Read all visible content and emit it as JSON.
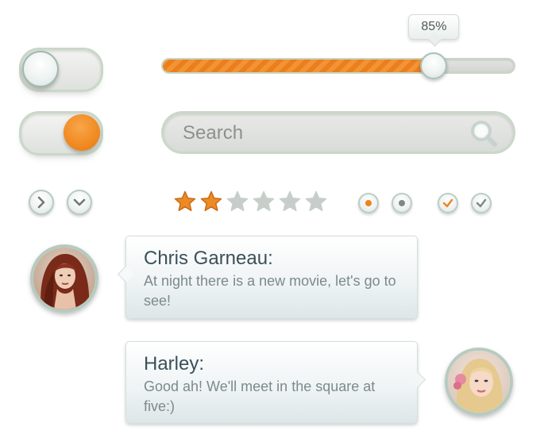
{
  "colors": {
    "accent": "#f08a21",
    "border": "#c9d8c8",
    "text_dark": "#3b5059",
    "text_muted": "#7c8a8e"
  },
  "toggles": [
    {
      "state": "off"
    },
    {
      "state": "on"
    }
  ],
  "slider": {
    "value_label": "85%",
    "value_fraction": 0.77
  },
  "search": {
    "placeholder": "Search",
    "icon": "magnifier-icon"
  },
  "nav_buttons": [
    {
      "icon": "chevron-right-icon"
    },
    {
      "icon": "chevron-down-icon"
    }
  ],
  "rating": {
    "value": 2,
    "max": 6
  },
  "radios": [
    {
      "selected": true
    },
    {
      "selected": false
    }
  ],
  "checkboxes": [
    {
      "checked": true
    },
    {
      "checked": false
    }
  ],
  "chat": [
    {
      "name": "Chris Garneau:",
      "message": "At night there is a new movie, let's go to see!",
      "avatar": "avatar-red-hair-woman"
    },
    {
      "name": "Harley:",
      "message": "Good ah! We'll meet in the square at five:)",
      "avatar": "avatar-blonde-woman"
    }
  ]
}
